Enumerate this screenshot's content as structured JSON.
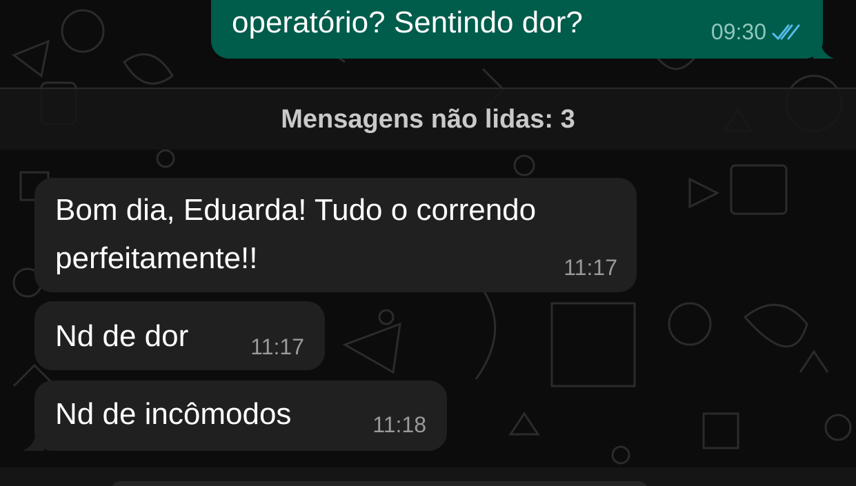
{
  "chat": {
    "outgoing": {
      "text": "operatório? Sentindo dor?",
      "time": "09:30",
      "status_icon": "double-check-read-icon"
    },
    "unread_banner": "Mensagens não lidas: 3",
    "incoming": [
      {
        "line1": "Bom dia, Eduarda! Tudo o correndo",
        "line2": "perfeitamente!!",
        "time": "11:17"
      },
      {
        "text": "Nd de dor",
        "time": "11:17"
      },
      {
        "text": "Nd de incômodos",
        "time": "11:18"
      }
    ]
  },
  "colors": {
    "outgoing_bubble": "#005c4b",
    "incoming_bubble": "#202020",
    "read_ticks": "#53bdeb",
    "background": "#0c0c0c"
  }
}
